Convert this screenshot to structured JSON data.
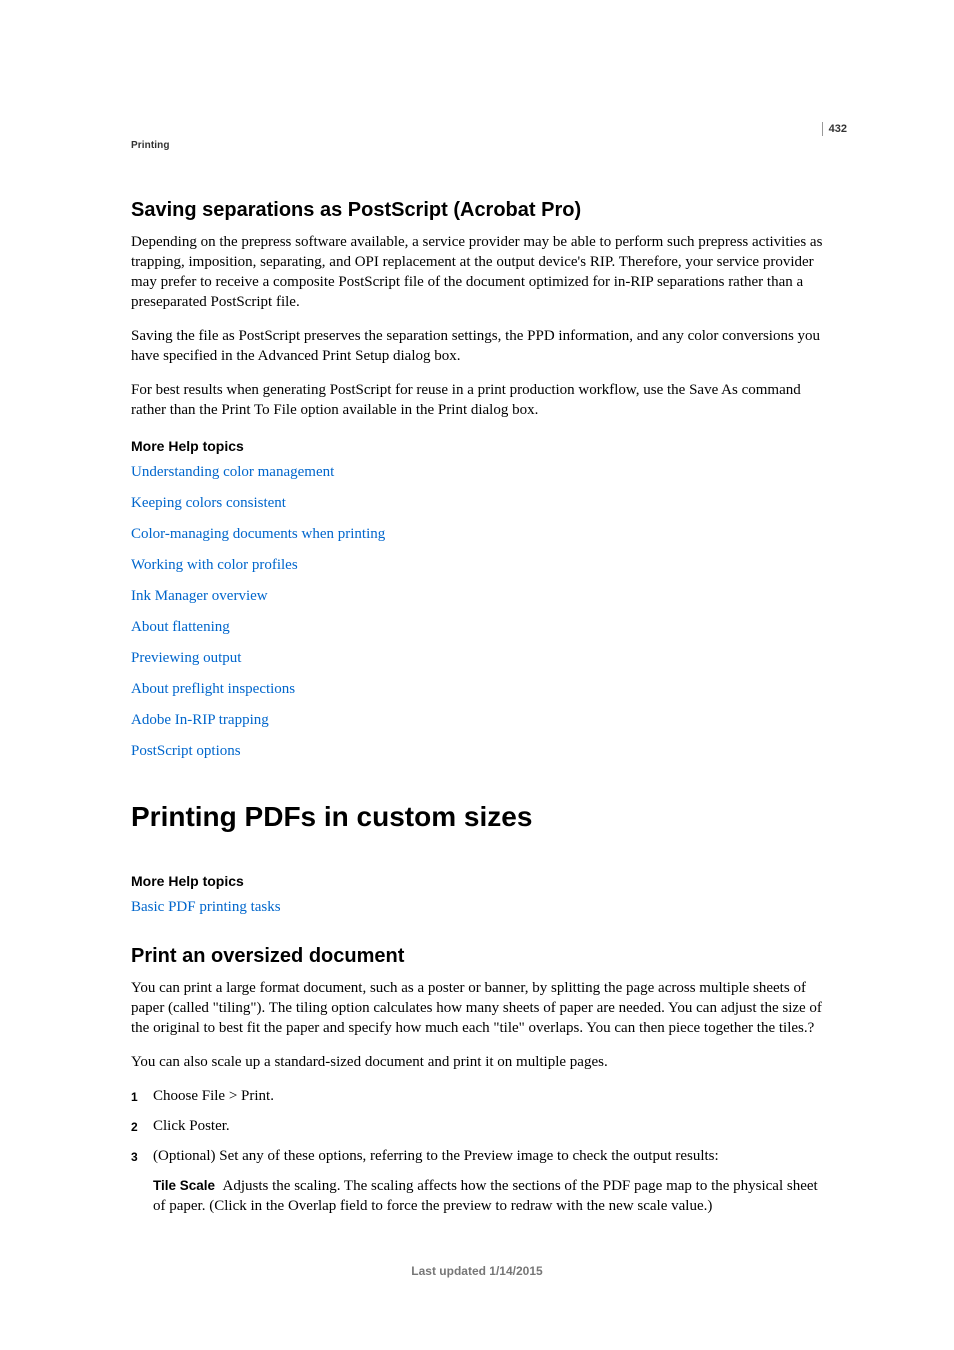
{
  "pageNumber": "432",
  "sectionLabel": "Printing",
  "heading2a": "Saving separations as PostScript (Acrobat Pro)",
  "para1": "Depending on the prepress software available, a service provider may be able to perform such prepress activities as trapping, imposition, separating, and OPI replacement at the output device's RIP. Therefore, your service provider may prefer to receive a composite PostScript file of the document optimized for in-RIP separations rather than a preseparated PostScript file.",
  "para2": "Saving the file as PostScript preserves the separation settings, the PPD information, and any color conversions you have specified in the Advanced Print Setup dialog box.",
  "para3": "For best results when generating PostScript for reuse in a print production workflow, use the Save As command rather than the Print To File option available in the Print dialog box.",
  "moreHelpLabel": "More Help topics",
  "links1": [
    "Understanding color management",
    "Keeping colors consistent",
    "Color-managing documents when printing",
    "Working with color profiles",
    "Ink Manager overview",
    "About flattening",
    "Previewing output",
    "About preflight inspections",
    "Adobe In-RIP trapping",
    "PostScript options"
  ],
  "heading1": "Printing PDFs in custom sizes",
  "links2": [
    "Basic PDF printing tasks"
  ],
  "heading2b": "Print an oversized document",
  "para4": "You can print a large format document, such as a poster or banner, by splitting the page across multiple sheets of paper (called \"tiling\"). The tiling option calculates how many sheets of paper are needed. You can adjust the size of the original to best fit the paper and specify how much each \"tile\" overlaps. You can then piece together the tiles.?",
  "para5": "You can also scale up a standard-sized document and print it on multiple pages.",
  "steps": [
    "Choose File > Print.",
    "Click Poster.",
    "(Optional) Set any of these options, referring to the Preview image to check the output results:"
  ],
  "defTerm": "Tile Scale",
  "defBody": "Adjusts the scaling. The scaling affects how the sections of the PDF page map to the physical sheet of paper. (Click in the Overlap field to force the preview to redraw with the new scale value.)",
  "footer": "Last updated 1/14/2015"
}
